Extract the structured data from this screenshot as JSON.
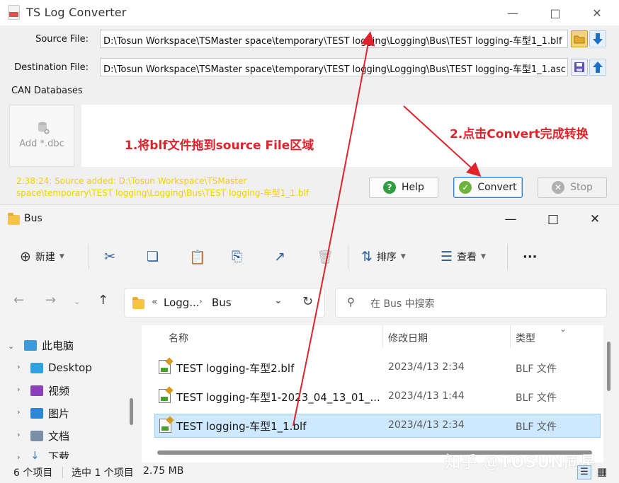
{
  "converter": {
    "title": "TS Log Converter",
    "source_label": "Source File:",
    "source_path": "D:\\Tosun Workspace\\TSMaster space\\temporary\\TEST logging\\Logging\\Bus\\TEST logging-车型1_1.blf",
    "dest_label": "Destination File:",
    "dest_path": "D:\\Tosun Workspace\\TSMaster space\\temporary\\TEST logging\\Logging\\Bus\\TEST logging-车型1_1.asc",
    "can_databases_label": "CAN Databases",
    "add_dbc_label": "Add *.dbc",
    "status_message": "2:38:24: Source added: D:\\Tosun Workspace\\TSMaster space\\temporary\\TEST logging\\Logging\\Bus\\TEST logging-车型1_1.blf",
    "help_label": "Help",
    "convert_label": "Convert",
    "stop_label": "Stop"
  },
  "annotations": {
    "step1": "1.将blf文件拖到source File区域",
    "step2": "2.点击Convert完成转换",
    "color": "#e0222b"
  },
  "explorer": {
    "title": "Bus",
    "toolbar": {
      "new_label": "新建",
      "sort_label": "排序",
      "view_label": "查看",
      "more_label": "···"
    },
    "breadcrumb": {
      "overflow": "«",
      "parent": "Logg...",
      "current": "Bus"
    },
    "search_placeholder": "在 Bus 中搜索",
    "tree": [
      {
        "label": "此电脑"
      },
      {
        "label": "Desktop"
      },
      {
        "label": "视频"
      },
      {
        "label": "图片"
      },
      {
        "label": "文档"
      },
      {
        "label": "下载"
      }
    ],
    "columns": {
      "name": "名称",
      "modified": "修改日期",
      "type": "类型"
    },
    "files": [
      {
        "name": "TEST logging-车型2.blf",
        "modified": "2023/4/13 2:34",
        "type": "BLF 文件"
      },
      {
        "name": "TEST logging-车型1-2023_04_13_01_...",
        "modified": "2023/4/13 1:44",
        "type": "BLF 文件"
      },
      {
        "name": "TEST logging-车型1_1.blf",
        "modified": "2023/4/13 2:34",
        "type": "BLF 文件"
      }
    ],
    "status": {
      "count": "6 个项目",
      "selected": "选中 1 个项目",
      "size": "2.75 MB"
    }
  },
  "watermark": "知乎 @TOSUN同星"
}
